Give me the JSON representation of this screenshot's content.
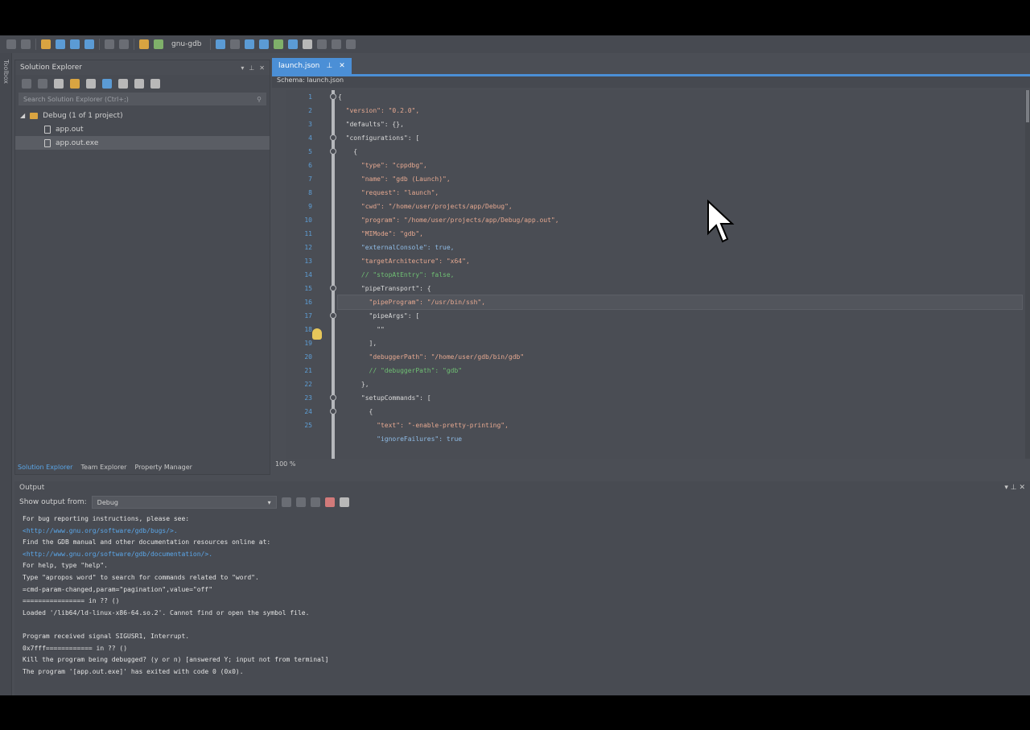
{
  "toolbar": {
    "config": "gnu-gdb"
  },
  "left_strip": {
    "label": "Toolbox"
  },
  "solution_explorer": {
    "title": "Solution Explorer",
    "search_placeholder": "Search Solution Explorer (Ctrl+;)",
    "tree": [
      {
        "label": "Debug (1 of 1 project)",
        "icon": "folder-icon"
      },
      {
        "label": "app.out",
        "icon": "file-icon"
      },
      {
        "label": "app.out.exe",
        "icon": "file-icon"
      }
    ],
    "bottom_tabs": [
      "Solution Explorer",
      "Team Explorer",
      "Property Manager"
    ]
  },
  "editor": {
    "tab": "launch.json",
    "path": "Schema: launch.json",
    "line_numbers": [
      "1",
      "2",
      "3",
      "4",
      "5",
      "6",
      "7",
      "8",
      "9",
      "10",
      "11",
      "12",
      "13",
      "14",
      "15",
      "16",
      "17",
      "18",
      "19",
      "20",
      "21",
      "22",
      "23",
      "24",
      "25"
    ],
    "lines": [
      {
        "text": "{"
      },
      {
        "text": "  \"version\": \"0.2.0\","
      },
      {
        "text": "  \"defaults\": {},"
      },
      {
        "text": "  \"configurations\": ["
      },
      {
        "text": "    {"
      },
      {
        "text": "      \"type\": \"cppdbg\","
      },
      {
        "text": "      \"name\": \"gdb (Launch)\","
      },
      {
        "text": "      \"request\": \"launch\","
      },
      {
        "text": "      \"cwd\": \"/home/user/projects/app/Debug\","
      },
      {
        "text": "      \"program\": \"/home/user/projects/app/Debug/app.out\","
      },
      {
        "text": "      \"MIMode\": \"gdb\","
      },
      {
        "text": "      \"externalConsole\": true,"
      },
      {
        "text": "      \"targetArchitecture\": \"x64\","
      },
      {
        "text": "      // \"stopAtEntry\": false,"
      },
      {
        "text": "      \"pipeTransport\": {"
      },
      {
        "text": "        \"pipeProgram\": \"/usr/bin/ssh\","
      },
      {
        "text": "        \"pipeArgs\": ["
      },
      {
        "text": "          \"\""
      },
      {
        "text": "        ],"
      },
      {
        "text": "        \"debuggerPath\": \"/home/user/gdb/bin/gdb\""
      },
      {
        "text": "        // \"debuggerPath\": \"gdb\""
      },
      {
        "text": "      },"
      },
      {
        "text": "      \"setupCommands\": ["
      },
      {
        "text": "        {"
      },
      {
        "text": "          \"text\": \"-enable-pretty-printing\","
      },
      {
        "text": "          \"ignoreFailures\": true"
      }
    ],
    "status": "100 %"
  },
  "output": {
    "title": "Output",
    "show_from_label": "Show output from:",
    "show_from_value": "Debug",
    "lines": [
      "For bug reporting instructions, please see:",
      "<http://www.gnu.org/software/gdb/bugs/>.",
      "Find the GDB manual and other documentation resources online at:",
      "<http://www.gnu.org/software/gdb/documentation/>.",
      "For help, type \"help\".",
      "Type \"apropos word\" to search for commands related to \"word\".",
      "=cmd-param-changed,param=\"pagination\",value=\"off\"",
      "================ in ?? ()",
      "Loaded '/lib64/ld-linux-x86-64.so.2'. Cannot find or open the symbol file.",
      "",
      "Program received signal SIGUSR1, Interrupt.",
      "0x7fff============ in ?? ()",
      "Kill the program being debugged? (y or n) [answered Y; input not from terminal]",
      "The program '[app.out.exe]' has exited with code 0 (0x0)."
    ],
    "link_lines": [
      1,
      3
    ]
  }
}
